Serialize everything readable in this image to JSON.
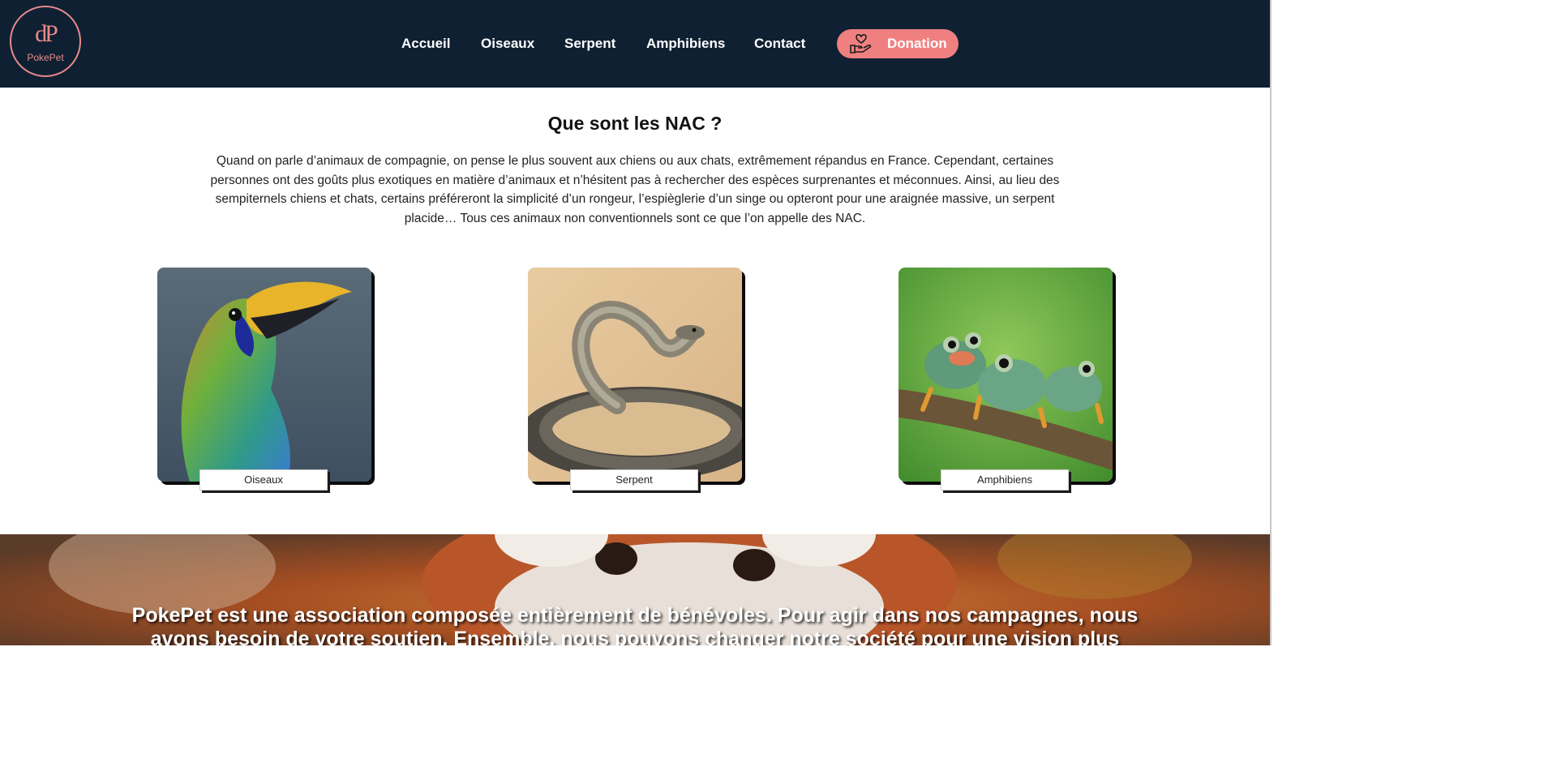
{
  "brand": {
    "monogram": "dP",
    "name": "PokePet",
    "accent_color": "#f08080",
    "header_bg": "#0f2033"
  },
  "nav": {
    "items": [
      {
        "label": "Accueil"
      },
      {
        "label": "Oiseaux"
      },
      {
        "label": "Serpent"
      },
      {
        "label": "Amphibiens"
      },
      {
        "label": "Contact"
      }
    ],
    "donation": {
      "label": "Donation",
      "icon": "heart-hand-icon"
    }
  },
  "intro": {
    "title": "Que sont les NAC ?",
    "text": "Quand on parle d’animaux de compagnie, on pense le plus souvent aux chiens ou aux chats, extrêmement répandus en France. Cependant, certaines personnes ont des goûts plus exotiques en matière d’animaux et n’hésitent pas à rechercher des espèces surprenantes et méconnues. Ainsi, au lieu des sempiternels chiens et chats, certains préféreront la simplicité d’un rongeur, l’espièglerie d’un singe ou opteront pour une araignée massive, un serpent placide… Tous ces animaux non conventionnels sont ce que l’on appelle des NAC."
  },
  "cards": [
    {
      "label": "Oiseaux",
      "image": "toucan-photo"
    },
    {
      "label": "Serpent",
      "image": "snake-photo"
    },
    {
      "label": "Amphibiens",
      "image": "frogs-photo"
    }
  ],
  "banner": {
    "image": "red-panda-photo",
    "text": "PokePet est une association composée entièrement de bénévoles. Pour agir dans nos campagnes, nous avons besoin de votre soutien. Ensemble, nous pouvons changer notre société pour une vision plus"
  }
}
